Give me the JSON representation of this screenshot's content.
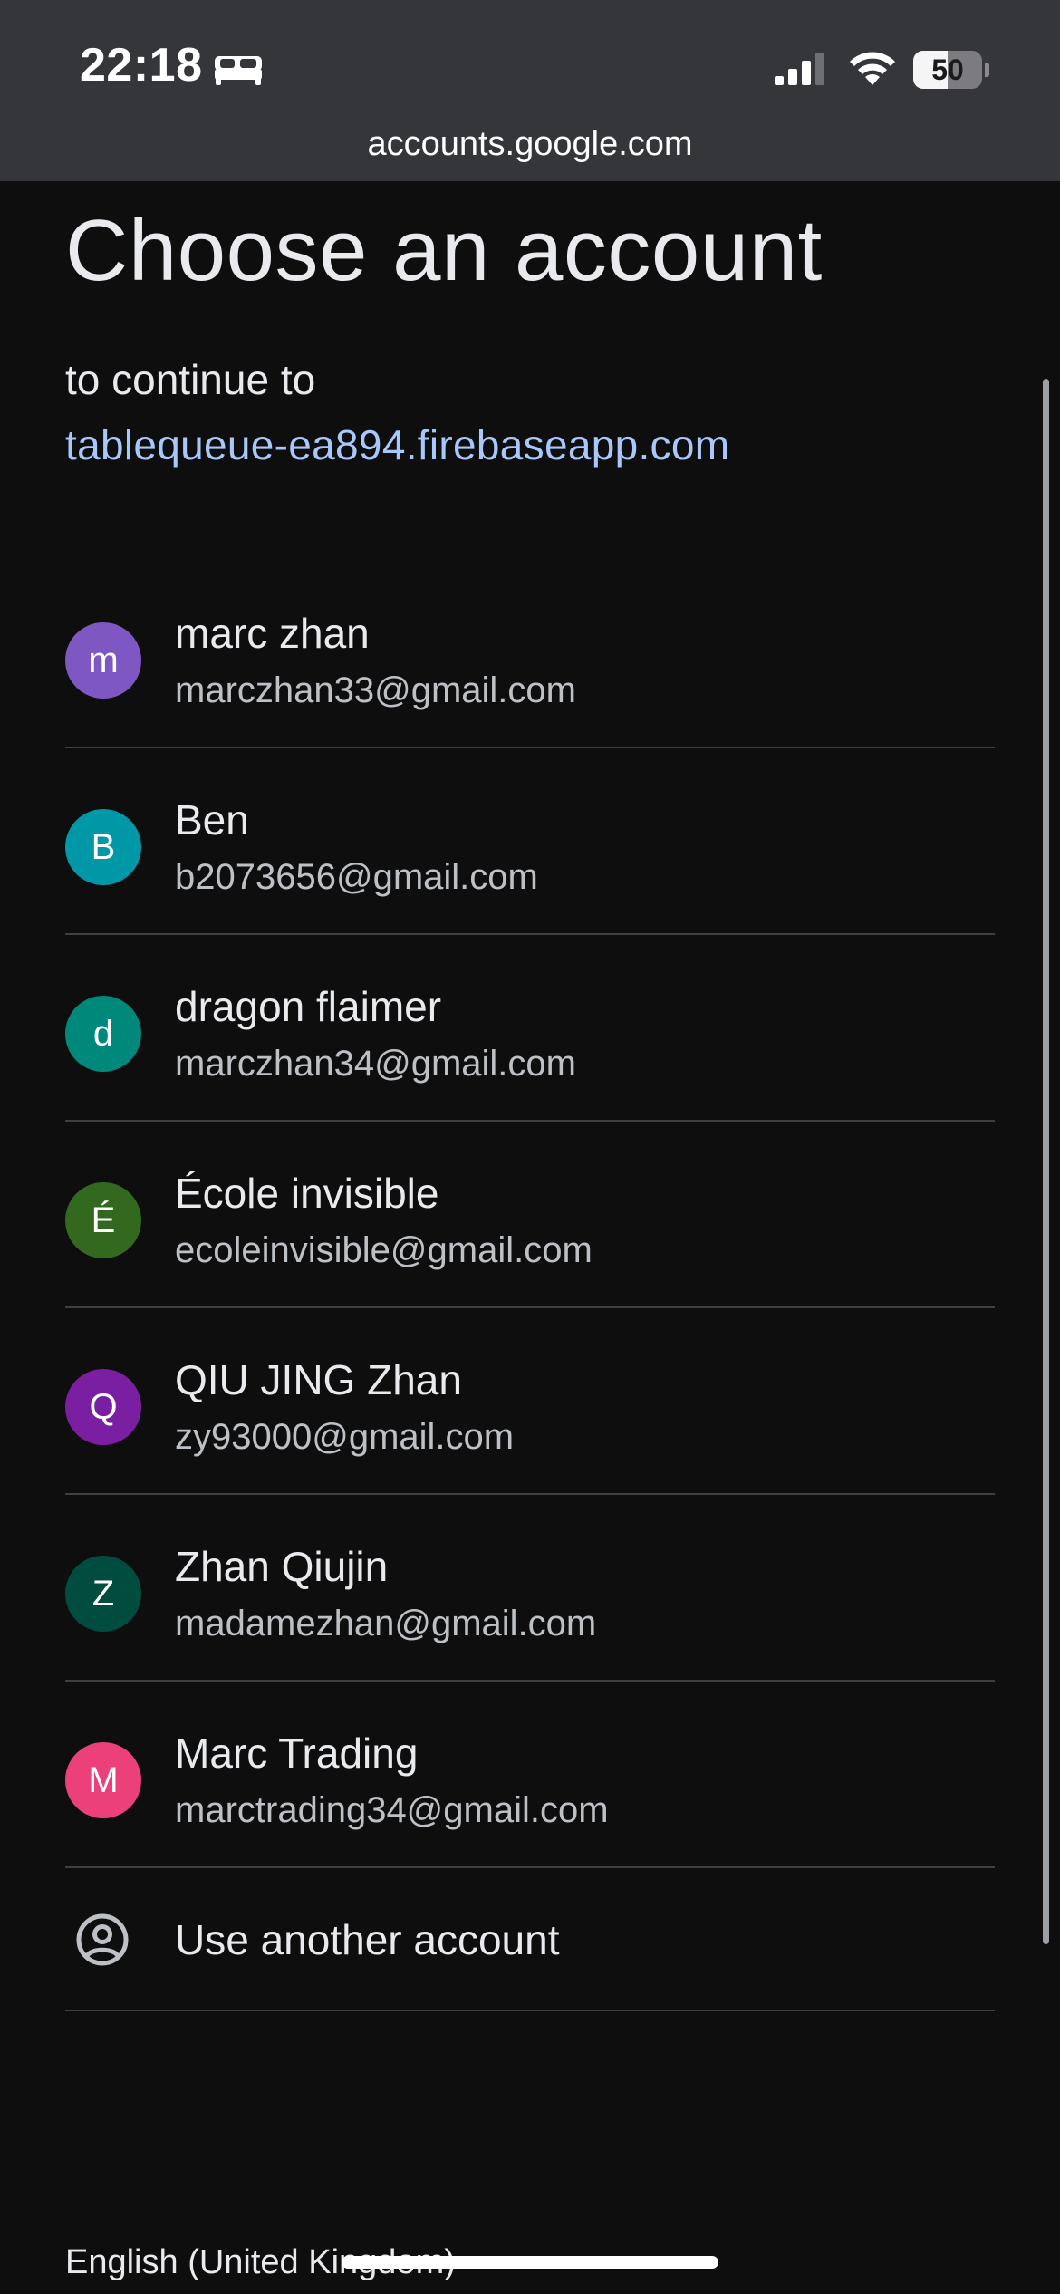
{
  "status_bar": {
    "time": "22:18",
    "sleep_icon": "bed-icon",
    "signal_icon": "cellular-signal-icon",
    "wifi_icon": "wifi-icon",
    "battery_level": "50",
    "battery_fraction": 0.5
  },
  "browser": {
    "url": "accounts.google.com"
  },
  "page": {
    "title": "Choose an account",
    "continue_label": "to continue to",
    "app_link": "tablequeue-ea894.firebaseapp.com"
  },
  "accounts": [
    {
      "initial": "m",
      "name": "marc zhan",
      "email": "marczhan33@gmail.com",
      "color": "#7e57c2"
    },
    {
      "initial": "B",
      "name": "Ben",
      "email": "b2073656@gmail.com",
      "color": "#0097a7"
    },
    {
      "initial": "d",
      "name": "dragon flaimer",
      "email": "marczhan34@gmail.com",
      "color": "#00897b"
    },
    {
      "initial": "É",
      "name": "École invisible",
      "email": "ecoleinvisible@gmail.com",
      "color": "#33691e"
    },
    {
      "initial": "Q",
      "name": "QIU JING Zhan",
      "email": "zy93000@gmail.com",
      "color": "#7b1fa2"
    },
    {
      "initial": "Z",
      "name": "Zhan Qiujin",
      "email": "madamezhan@gmail.com",
      "color": "#004d40"
    },
    {
      "initial": "M",
      "name": "Marc Trading",
      "email": "marctrading34@gmail.com",
      "color": "#ec407a"
    }
  ],
  "another_account": {
    "label": "Use another account",
    "icon": "account-circle-icon"
  },
  "footer": {
    "language": "English (United Kingdom)"
  }
}
